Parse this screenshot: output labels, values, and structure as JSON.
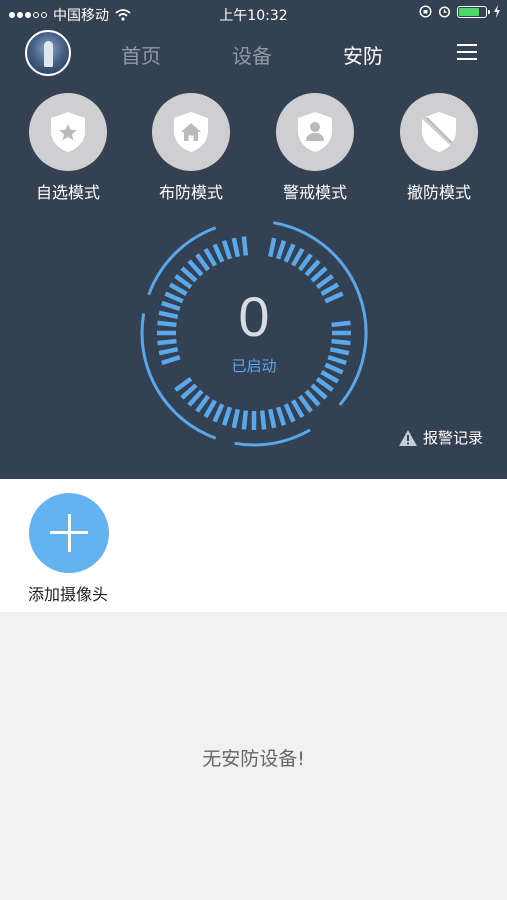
{
  "status_bar": {
    "carrier": "中国移动",
    "time": "上午10:32"
  },
  "nav": {
    "tabs": [
      {
        "label": "首页"
      },
      {
        "label": "设备"
      },
      {
        "label": "安防"
      }
    ],
    "active_tab": "安防"
  },
  "modes": [
    {
      "label": "自选模式",
      "icon": "star-shield-icon"
    },
    {
      "label": "布防模式",
      "icon": "home-shield-icon"
    },
    {
      "label": "警戒模式",
      "icon": "person-shield-icon"
    },
    {
      "label": "撤防模式",
      "icon": "disabled-shield-icon"
    }
  ],
  "gauge": {
    "count": "0",
    "state": "已启动"
  },
  "alarm_record": {
    "label": "报警记录"
  },
  "add_camera": {
    "label": "添加摄像头"
  },
  "empty_state": "无安防设备!",
  "colors": {
    "header_bg": "#344152",
    "accent": "#5aa8ec",
    "add_button": "#63b3f1"
  }
}
